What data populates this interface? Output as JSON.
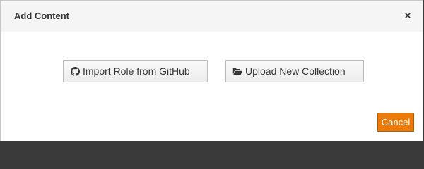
{
  "dialog": {
    "title": "Add Content",
    "close_label": "×"
  },
  "actions": {
    "import_github": {
      "label": "Import Role from GitHub",
      "icon": "github-icon"
    },
    "upload_collection": {
      "label": "Upload New Collection",
      "icon": "folder-open-icon"
    }
  },
  "footer": {
    "cancel_label": "Cancel"
  },
  "colors": {
    "cancel_button": "#ec7a08",
    "header_background": "#f5f5f5"
  }
}
